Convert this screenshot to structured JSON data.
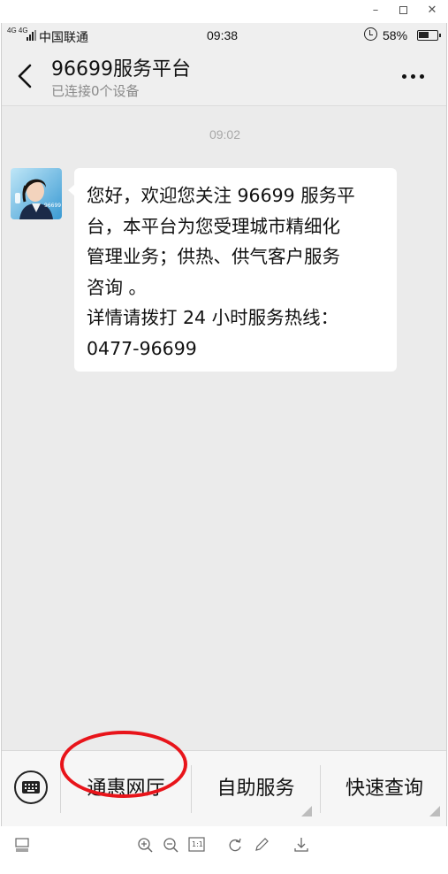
{
  "window": {
    "minimize_label": "–",
    "close_label": "✕"
  },
  "status_bar": {
    "network": "4G 4G",
    "carrier": "中国联通",
    "time": "09:38",
    "battery_percent": "58%",
    "battery_level": 0.58
  },
  "header": {
    "title": "96699服务平台",
    "subtitle": "已连接0个设备",
    "back_icon": "chevron-left-icon",
    "more_icon": "more-dots-icon"
  },
  "chat": {
    "timestamp": "09:02",
    "messages": [
      {
        "lines": [
          "您好，欢迎您关注 96699 服务平",
          "台，本平台为您受理城市精细化",
          "管理业务；供热、供气客户服务",
          "咨询 。",
          "详情请拨打 24 小时服务热线：",
          "0477-96699"
        ]
      }
    ]
  },
  "menu": {
    "keyboard_icon": "keyboard-icon",
    "items": [
      {
        "label": "通惠网厅"
      },
      {
        "label": "自助服务"
      },
      {
        "label": "快速查询"
      }
    ]
  },
  "colors": {
    "chat_background": "#ebebeb",
    "bubble": "#ffffff",
    "highlight_oval": "#e8141a",
    "subtitle": "#8a8a8a"
  },
  "viewer_toolbar": {
    "icons": [
      "layout-icon",
      "zoom-in-icon",
      "zoom-out-icon",
      "actual-size-icon",
      "rotate-icon",
      "edit-icon",
      "download-icon"
    ],
    "actual_size_label": "1:1"
  }
}
